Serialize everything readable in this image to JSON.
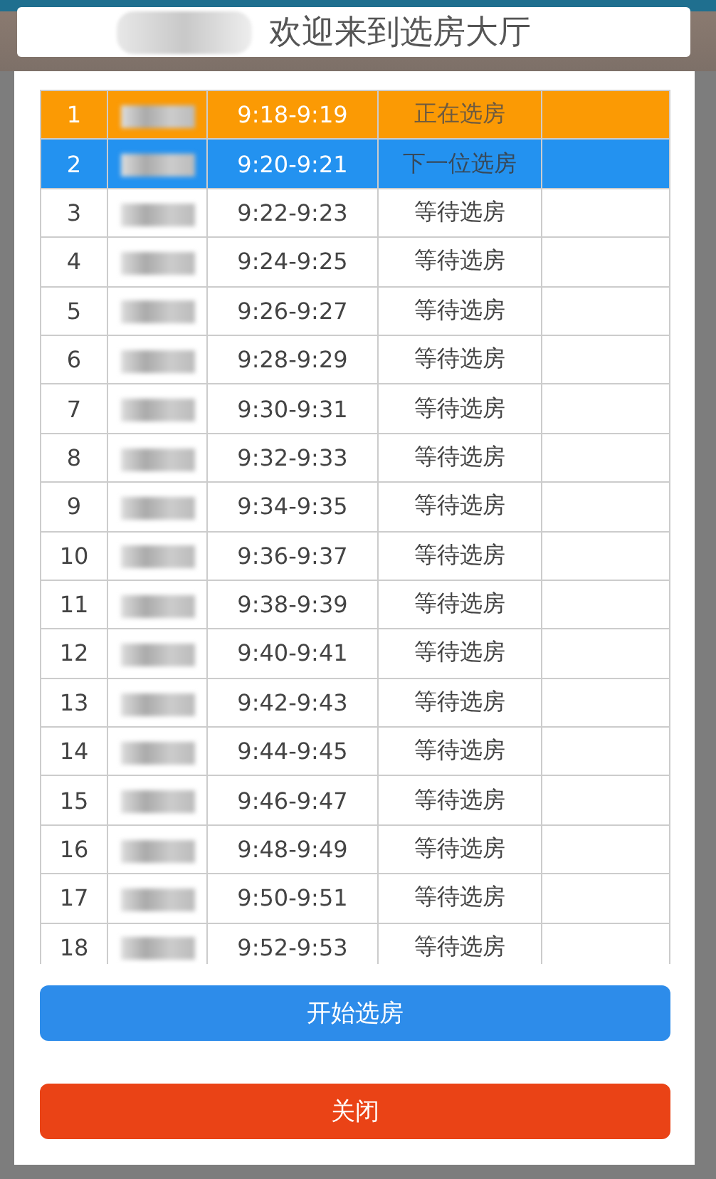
{
  "banner": {
    "title": "欢迎来到选房大厅"
  },
  "queue": [
    {
      "no": "1",
      "time": "9:18-9:19",
      "status": "正在选房",
      "kind": "current"
    },
    {
      "no": "2",
      "time": "9:20-9:21",
      "status": "下一位选房",
      "kind": "next"
    },
    {
      "no": "3",
      "time": "9:22-9:23",
      "status": "等待选房",
      "kind": "waiting"
    },
    {
      "no": "4",
      "time": "9:24-9:25",
      "status": "等待选房",
      "kind": "waiting"
    },
    {
      "no": "5",
      "time": "9:26-9:27",
      "status": "等待选房",
      "kind": "waiting"
    },
    {
      "no": "6",
      "time": "9:28-9:29",
      "status": "等待选房",
      "kind": "waiting"
    },
    {
      "no": "7",
      "time": "9:30-9:31",
      "status": "等待选房",
      "kind": "waiting"
    },
    {
      "no": "8",
      "time": "9:32-9:33",
      "status": "等待选房",
      "kind": "waiting"
    },
    {
      "no": "9",
      "time": "9:34-9:35",
      "status": "等待选房",
      "kind": "waiting"
    },
    {
      "no": "10",
      "time": "9:36-9:37",
      "status": "等待选房",
      "kind": "waiting"
    },
    {
      "no": "11",
      "time": "9:38-9:39",
      "status": "等待选房",
      "kind": "waiting"
    },
    {
      "no": "12",
      "time": "9:40-9:41",
      "status": "等待选房",
      "kind": "waiting"
    },
    {
      "no": "13",
      "time": "9:42-9:43",
      "status": "等待选房",
      "kind": "waiting"
    },
    {
      "no": "14",
      "time": "9:44-9:45",
      "status": "等待选房",
      "kind": "waiting"
    },
    {
      "no": "15",
      "time": "9:46-9:47",
      "status": "等待选房",
      "kind": "waiting"
    },
    {
      "no": "16",
      "time": "9:48-9:49",
      "status": "等待选房",
      "kind": "waiting"
    },
    {
      "no": "17",
      "time": "9:50-9:51",
      "status": "等待选房",
      "kind": "waiting"
    },
    {
      "no": "18",
      "time": "9:52-9:53",
      "status": "等待选房",
      "kind": "waiting"
    }
  ],
  "buttons": [
    {
      "label": "开始选房",
      "kind": "primary"
    },
    {
      "label": "关闭",
      "kind": "danger"
    }
  ]
}
